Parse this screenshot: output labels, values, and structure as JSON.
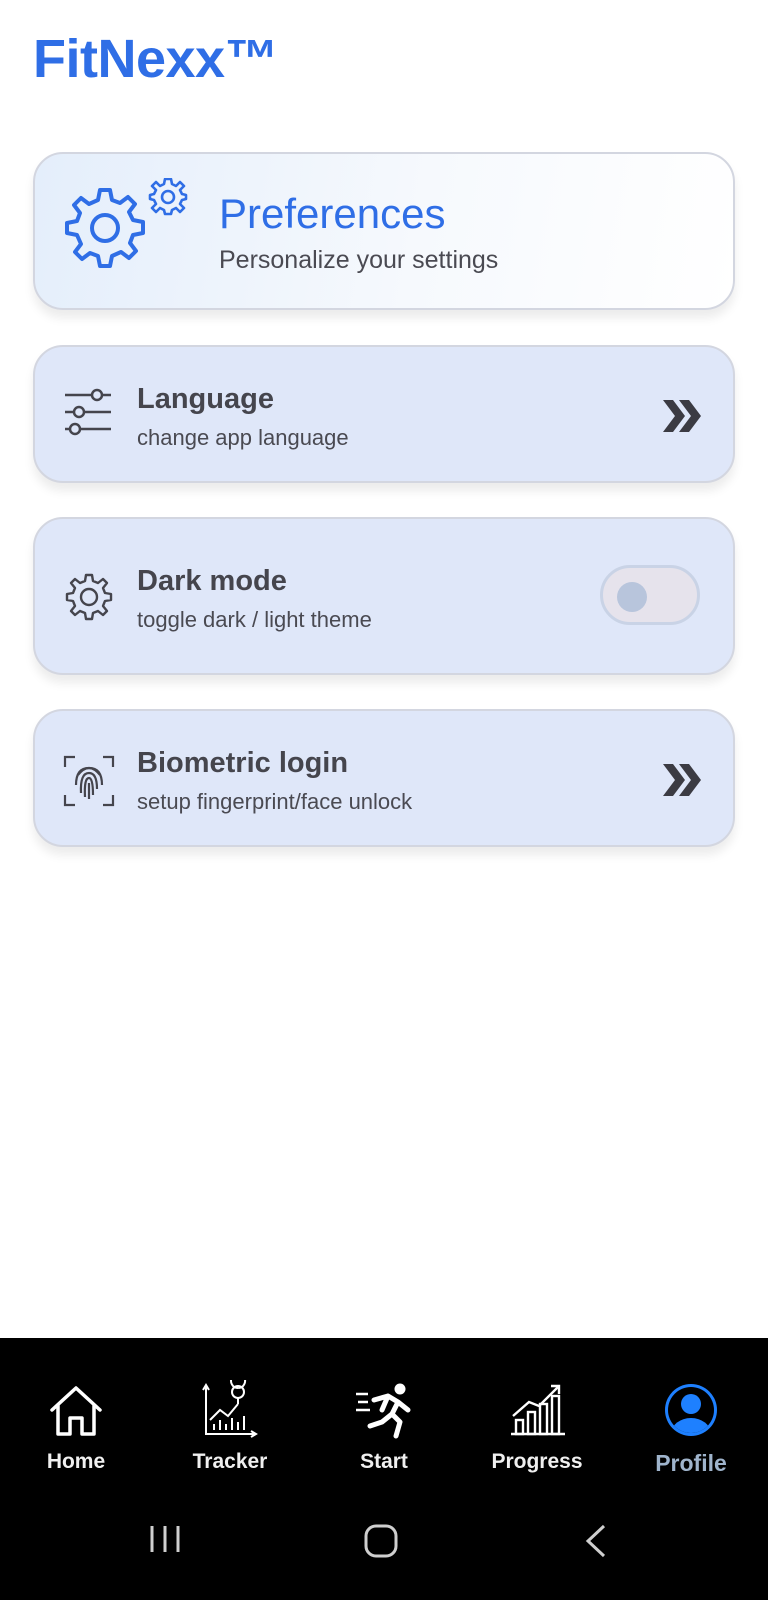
{
  "app": {
    "title": "FitNexx™"
  },
  "preferences": {
    "title": "Preferences",
    "subtitle": "Personalize your settings",
    "icon": "gears-icon"
  },
  "options": [
    {
      "title": "Language",
      "subtitle": "change app language",
      "icon": "sliders-icon",
      "action": "chevron"
    },
    {
      "title": "Dark mode",
      "subtitle": "toggle dark / light theme",
      "icon": "gear-icon",
      "action": "toggle",
      "toggle_on": false
    },
    {
      "title": "Biometric login",
      "subtitle": "setup fingerprint/face unlock",
      "icon": "fingerprint-icon",
      "action": "chevron"
    }
  ],
  "nav": {
    "items": [
      {
        "label": "Home",
        "icon": "home-icon"
      },
      {
        "label": "Tracker",
        "icon": "tracker-chart-icon"
      },
      {
        "label": "Start",
        "icon": "running-person-icon"
      },
      {
        "label": "Progress",
        "icon": "progress-bars-icon"
      },
      {
        "label": "Profile",
        "icon": "profile-avatar-icon",
        "active": true
      }
    ]
  },
  "colors": {
    "brand": "#2f6ee6",
    "card_bg": "#dfe7f9",
    "nav_bg": "#000000",
    "active_label": "#9fb4cc"
  }
}
